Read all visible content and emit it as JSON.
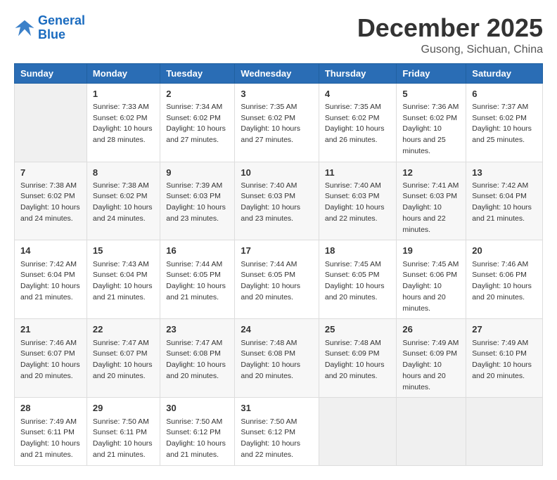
{
  "header": {
    "logo_line1": "General",
    "logo_line2": "Blue",
    "month_year": "December 2025",
    "location": "Gusong, Sichuan, China"
  },
  "weekdays": [
    "Sunday",
    "Monday",
    "Tuesday",
    "Wednesday",
    "Thursday",
    "Friday",
    "Saturday"
  ],
  "weeks": [
    [
      {
        "day": "",
        "sunrise": "",
        "sunset": "",
        "daylight": ""
      },
      {
        "day": "1",
        "sunrise": "Sunrise: 7:33 AM",
        "sunset": "Sunset: 6:02 PM",
        "daylight": "Daylight: 10 hours and 28 minutes."
      },
      {
        "day": "2",
        "sunrise": "Sunrise: 7:34 AM",
        "sunset": "Sunset: 6:02 PM",
        "daylight": "Daylight: 10 hours and 27 minutes."
      },
      {
        "day": "3",
        "sunrise": "Sunrise: 7:35 AM",
        "sunset": "Sunset: 6:02 PM",
        "daylight": "Daylight: 10 hours and 27 minutes."
      },
      {
        "day": "4",
        "sunrise": "Sunrise: 7:35 AM",
        "sunset": "Sunset: 6:02 PM",
        "daylight": "Daylight: 10 hours and 26 minutes."
      },
      {
        "day": "5",
        "sunrise": "Sunrise: 7:36 AM",
        "sunset": "Sunset: 6:02 PM",
        "daylight": "Daylight: 10 hours and 25 minutes."
      },
      {
        "day": "6",
        "sunrise": "Sunrise: 7:37 AM",
        "sunset": "Sunset: 6:02 PM",
        "daylight": "Daylight: 10 hours and 25 minutes."
      }
    ],
    [
      {
        "day": "7",
        "sunrise": "Sunrise: 7:38 AM",
        "sunset": "Sunset: 6:02 PM",
        "daylight": "Daylight: 10 hours and 24 minutes."
      },
      {
        "day": "8",
        "sunrise": "Sunrise: 7:38 AM",
        "sunset": "Sunset: 6:02 PM",
        "daylight": "Daylight: 10 hours and 24 minutes."
      },
      {
        "day": "9",
        "sunrise": "Sunrise: 7:39 AM",
        "sunset": "Sunset: 6:03 PM",
        "daylight": "Daylight: 10 hours and 23 minutes."
      },
      {
        "day": "10",
        "sunrise": "Sunrise: 7:40 AM",
        "sunset": "Sunset: 6:03 PM",
        "daylight": "Daylight: 10 hours and 23 minutes."
      },
      {
        "day": "11",
        "sunrise": "Sunrise: 7:40 AM",
        "sunset": "Sunset: 6:03 PM",
        "daylight": "Daylight: 10 hours and 22 minutes."
      },
      {
        "day": "12",
        "sunrise": "Sunrise: 7:41 AM",
        "sunset": "Sunset: 6:03 PM",
        "daylight": "Daylight: 10 hours and 22 minutes."
      },
      {
        "day": "13",
        "sunrise": "Sunrise: 7:42 AM",
        "sunset": "Sunset: 6:04 PM",
        "daylight": "Daylight: 10 hours and 21 minutes."
      }
    ],
    [
      {
        "day": "14",
        "sunrise": "Sunrise: 7:42 AM",
        "sunset": "Sunset: 6:04 PM",
        "daylight": "Daylight: 10 hours and 21 minutes."
      },
      {
        "day": "15",
        "sunrise": "Sunrise: 7:43 AM",
        "sunset": "Sunset: 6:04 PM",
        "daylight": "Daylight: 10 hours and 21 minutes."
      },
      {
        "day": "16",
        "sunrise": "Sunrise: 7:44 AM",
        "sunset": "Sunset: 6:05 PM",
        "daylight": "Daylight: 10 hours and 21 minutes."
      },
      {
        "day": "17",
        "sunrise": "Sunrise: 7:44 AM",
        "sunset": "Sunset: 6:05 PM",
        "daylight": "Daylight: 10 hours and 20 minutes."
      },
      {
        "day": "18",
        "sunrise": "Sunrise: 7:45 AM",
        "sunset": "Sunset: 6:05 PM",
        "daylight": "Daylight: 10 hours and 20 minutes."
      },
      {
        "day": "19",
        "sunrise": "Sunrise: 7:45 AM",
        "sunset": "Sunset: 6:06 PM",
        "daylight": "Daylight: 10 hours and 20 minutes."
      },
      {
        "day": "20",
        "sunrise": "Sunrise: 7:46 AM",
        "sunset": "Sunset: 6:06 PM",
        "daylight": "Daylight: 10 hours and 20 minutes."
      }
    ],
    [
      {
        "day": "21",
        "sunrise": "Sunrise: 7:46 AM",
        "sunset": "Sunset: 6:07 PM",
        "daylight": "Daylight: 10 hours and 20 minutes."
      },
      {
        "day": "22",
        "sunrise": "Sunrise: 7:47 AM",
        "sunset": "Sunset: 6:07 PM",
        "daylight": "Daylight: 10 hours and 20 minutes."
      },
      {
        "day": "23",
        "sunrise": "Sunrise: 7:47 AM",
        "sunset": "Sunset: 6:08 PM",
        "daylight": "Daylight: 10 hours and 20 minutes."
      },
      {
        "day": "24",
        "sunrise": "Sunrise: 7:48 AM",
        "sunset": "Sunset: 6:08 PM",
        "daylight": "Daylight: 10 hours and 20 minutes."
      },
      {
        "day": "25",
        "sunrise": "Sunrise: 7:48 AM",
        "sunset": "Sunset: 6:09 PM",
        "daylight": "Daylight: 10 hours and 20 minutes."
      },
      {
        "day": "26",
        "sunrise": "Sunrise: 7:49 AM",
        "sunset": "Sunset: 6:09 PM",
        "daylight": "Daylight: 10 hours and 20 minutes."
      },
      {
        "day": "27",
        "sunrise": "Sunrise: 7:49 AM",
        "sunset": "Sunset: 6:10 PM",
        "daylight": "Daylight: 10 hours and 20 minutes."
      }
    ],
    [
      {
        "day": "28",
        "sunrise": "Sunrise: 7:49 AM",
        "sunset": "Sunset: 6:11 PM",
        "daylight": "Daylight: 10 hours and 21 minutes."
      },
      {
        "day": "29",
        "sunrise": "Sunrise: 7:50 AM",
        "sunset": "Sunset: 6:11 PM",
        "daylight": "Daylight: 10 hours and 21 minutes."
      },
      {
        "day": "30",
        "sunrise": "Sunrise: 7:50 AM",
        "sunset": "Sunset: 6:12 PM",
        "daylight": "Daylight: 10 hours and 21 minutes."
      },
      {
        "day": "31",
        "sunrise": "Sunrise: 7:50 AM",
        "sunset": "Sunset: 6:12 PM",
        "daylight": "Daylight: 10 hours and 22 minutes."
      },
      {
        "day": "",
        "sunrise": "",
        "sunset": "",
        "daylight": ""
      },
      {
        "day": "",
        "sunrise": "",
        "sunset": "",
        "daylight": ""
      },
      {
        "day": "",
        "sunrise": "",
        "sunset": "",
        "daylight": ""
      }
    ]
  ]
}
